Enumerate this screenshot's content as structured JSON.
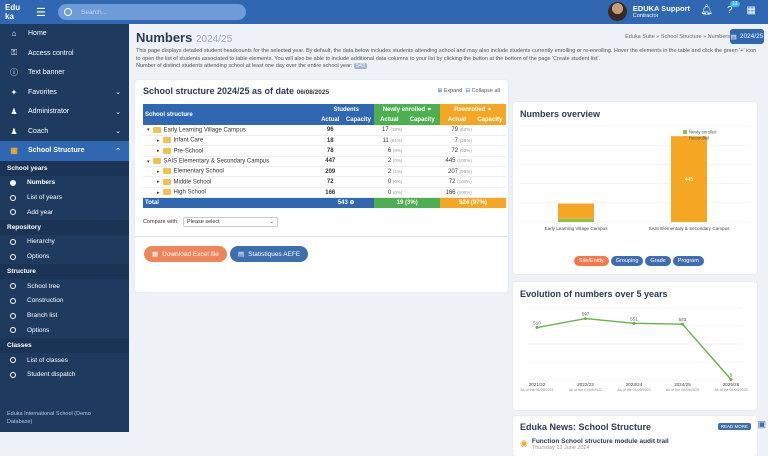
{
  "topbar": {
    "logo_line1": "Edu",
    "logo_line2": "ka",
    "search_placeholder": "Search...",
    "user_name": "EDUKA Support",
    "user_role": "Contractor",
    "notif_count": "13"
  },
  "sidebar": {
    "items": [
      {
        "label": "Home",
        "icon": "home-icon"
      },
      {
        "label": "Access control",
        "icon": "key-icon"
      },
      {
        "label": "Text banner",
        "icon": "info-icon"
      },
      {
        "label": "Favorites",
        "icon": "pin-icon"
      },
      {
        "label": "Administrator",
        "icon": "user-gear-icon"
      },
      {
        "label": "Coach",
        "icon": "user-gear-icon"
      },
      {
        "label": "School Structure",
        "icon": "grid-icon"
      }
    ],
    "groups": [
      {
        "title": "School years",
        "items": [
          "Numbers",
          "List of years",
          "Add year"
        ]
      },
      {
        "title": "Repository",
        "items": [
          "Hierarchy",
          "Options"
        ]
      },
      {
        "title": "Structure",
        "items": [
          "School tree",
          "Construction",
          "Branch list",
          "Options"
        ]
      },
      {
        "title": "Classes",
        "items": [
          "List of classes",
          "Student dispatch"
        ]
      }
    ],
    "footer": "Eduka International School (Demo Database)"
  },
  "page": {
    "title": "Numbers",
    "year": "2024/25",
    "breadcrumb": "Eduka Suite » School Structure » Numbers",
    "year_button": "2024/25",
    "description": "This page displays detailed student headcounts for the selected year. By default, the data below includes students attending school and may also include students currently enrolling or re-enrolling. Hover the elements in the table and click the green '+' icon to open the list of students associated to table elements. You will also be able to include additional data columns to your list by clicking the button at the bottom of the page 'Create student list'.",
    "distinct_label": "Number of distinct students attending school at least one day over the entire school year:",
    "distinct_value": "543"
  },
  "structure": {
    "title": "School structure 2024/25 as of date",
    "date": "06/08/2025",
    "expand": "Expand",
    "collapse": "Collapse all",
    "headers": {
      "col": "School structure",
      "students": "Students",
      "newly": "Newly enrolled",
      "reenrolled": "Reenrolled",
      "actual": "Actual",
      "capacity": "Capacity"
    },
    "rows": [
      {
        "name": "Early Learning Village Campus",
        "level": 0,
        "students": "96",
        "newly": "17",
        "newly_pct": "(18%)",
        "re": "79",
        "re_pct": "(82%)"
      },
      {
        "name": "Infant Care",
        "level": 1,
        "students": "18",
        "newly": "11",
        "newly_pct": "(61%)",
        "re": "7",
        "re_pct": "(39%)"
      },
      {
        "name": "Pre-School",
        "level": 1,
        "students": "78",
        "newly": "6",
        "newly_pct": "(8%)",
        "re": "72",
        "re_pct": "(92%)"
      },
      {
        "name": "SAIS Elementary & Secondary Campus",
        "level": 0,
        "students": "447",
        "newly": "2",
        "newly_pct": "(0%)",
        "re": "445",
        "re_pct": "(100%)"
      },
      {
        "name": "Elementary School",
        "level": 1,
        "students": "209",
        "newly": "2",
        "newly_pct": "(1%)",
        "re": "207",
        "re_pct": "(99%)"
      },
      {
        "name": "Middle School",
        "level": 1,
        "students": "72",
        "newly": "0",
        "newly_pct": "(0%)",
        "re": "72",
        "re_pct": "(100%)"
      },
      {
        "name": "High School",
        "level": 1,
        "students": "166",
        "newly": "0",
        "newly_pct": "(0%)",
        "re": "166",
        "re_pct": "(100%)"
      }
    ],
    "total": {
      "label": "Total",
      "students": "543",
      "newly": "19 (3%)",
      "re": "524 (97%)"
    },
    "compare_label": "Compare with:",
    "compare_value": "Please select",
    "excel_button": "Download Excel file",
    "stats_button": "Statistiques AEFE"
  },
  "overview": {
    "title": "Numbers overview",
    "tabs": [
      "Site/Entity",
      "Grouping",
      "Grade",
      "Program"
    ]
  },
  "evolution": {
    "title": "Evolution of numbers over 5 years"
  },
  "news": {
    "title": "Eduka News: School Structure",
    "more": "READ MORE",
    "item_title": "Function School structure module audit trail",
    "item_date": "Thursday 13 June 2024"
  },
  "colors": {
    "brand": "#2f67b2",
    "green": "#4caf50",
    "orange": "#f5a623",
    "sidebar": "#1e3a5f"
  },
  "chart_data": [
    {
      "type": "bar",
      "stacked": true,
      "categories": [
        "Early Learning Village Campus",
        "SAIS Elementary & Secondary Campus"
      ],
      "series": [
        {
          "name": "Newly enrolled",
          "values": [
            17,
            2
          ]
        },
        {
          "name": "Reenrolled",
          "values": [
            79,
            445
          ]
        }
      ],
      "data_labels": [
        [
          "17",
          "79"
        ],
        [
          "",
          "445"
        ]
      ],
      "ylim": [
        0,
        500
      ],
      "legend": "top-right",
      "grid": true
    },
    {
      "type": "line",
      "categories": [
        "2021/22",
        "2022/23",
        "2023/24",
        "2024/25",
        "2025/26"
      ],
      "sublabels": [
        "As of the 01/09/2021",
        "As of the 01/09/2022",
        "As of the 01/09/2023",
        "As of the 06/08/2025",
        "As of the 01/09/2025"
      ],
      "values": [
        510,
        597,
        551,
        543,
        5
      ],
      "ylim": [
        0,
        700
      ],
      "grid": true
    }
  ]
}
